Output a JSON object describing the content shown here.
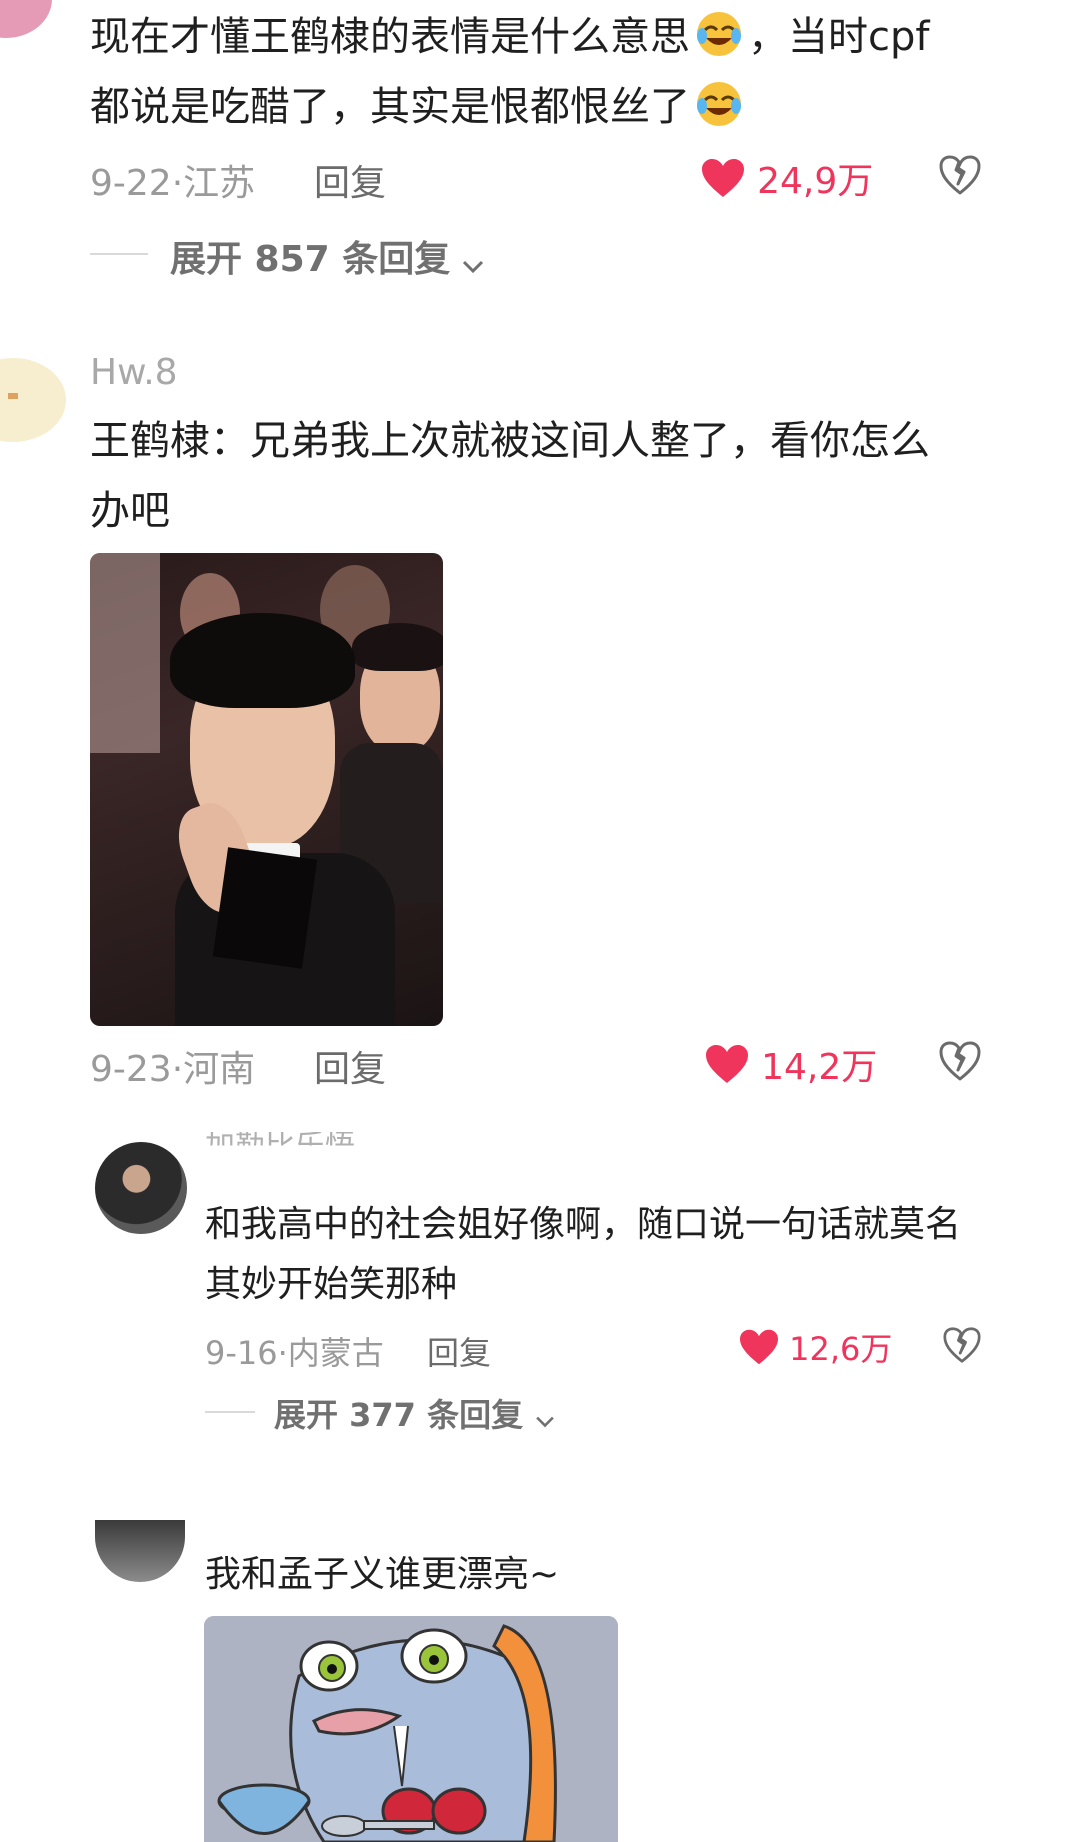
{
  "comments": [
    {
      "text_line1": "现在才懂王鹤棣的表情是什么意思",
      "text_line1_tail": "，当时cpf",
      "text_line2": "都说是吃醋了，其实是恨都恨丝了",
      "date_location": "9-22·江苏",
      "reply_label": "回复",
      "likes": "24,9万",
      "expand_label": "展开 857 条回复",
      "emoji_icon": "laughing-crying-emoji"
    },
    {
      "username": "Hw.8",
      "text_line1": "王鹤棣：兄弟我上次就被这间人整了，看你怎么",
      "text_line2": "办吧",
      "date_location": "9-23·河南",
      "reply_label": "回复",
      "likes": "14,2万"
    },
    {
      "username_partial": "加勒比乐悟",
      "text_line1": "和我高中的社会姐好像啊，随口说一句话就莫名",
      "text_line2": "其妙开始笑那种",
      "date_location": "9-16·内蒙古",
      "reply_label": "回复",
      "likes": "12,6万",
      "expand_label": "展开 377 条回复"
    },
    {
      "text_line1": "我和孟子义谁更漂亮~"
    }
  ],
  "colors": {
    "like_red": "#f0355d",
    "meta_gray": "#9a9a9a",
    "text_dark": "#1f1f1f"
  }
}
